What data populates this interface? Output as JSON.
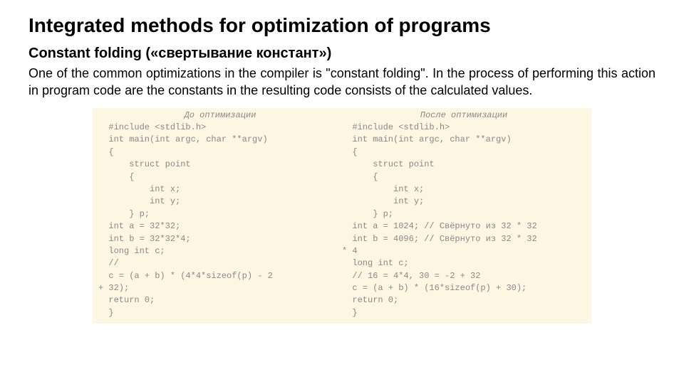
{
  "title": "Integrated methods for optimization of programs",
  "subtitle": "Constant folding («свертывание констант»)",
  "body": "One of the common optimizations in the compiler is \"constant folding\". In the process of performing this action in program code are the constants in the resulting code consists of the calculated values.",
  "code": {
    "header_left": "До оптимизации",
    "header_right": "После оптимизации",
    "left": [
      "  #include <stdlib.h>",
      "  int main(int argc, char **argv)",
      "  {",
      "      struct point",
      "      {",
      "          int x;",
      "          int y;",
      "      } p;",
      "  int a = 32*32;",
      "  int b = 32*32*4;",
      "  long int c;",
      "  //",
      "  c = (a + b) * (4*4*sizeof(p) - 2",
      "+ 32);",
      "  return 0;",
      "  }"
    ],
    "right": [
      "  #include <stdlib.h>",
      "  int main(int argc, char **argv)",
      "  {",
      "      struct point",
      "      {",
      "          int x;",
      "          int y;",
      "      } p;",
      "  int a = 1024; // Свёрнуто из 32 * 32",
      "  int b = 4096; // Свёрнуто из 32 * 32",
      "* 4",
      "  long int c;",
      "  // 16 = 4*4, 30 = -2 + 32",
      "  c = (a + b) * (16*sizeof(p) + 30);",
      "  return 0;",
      "  }"
    ]
  }
}
